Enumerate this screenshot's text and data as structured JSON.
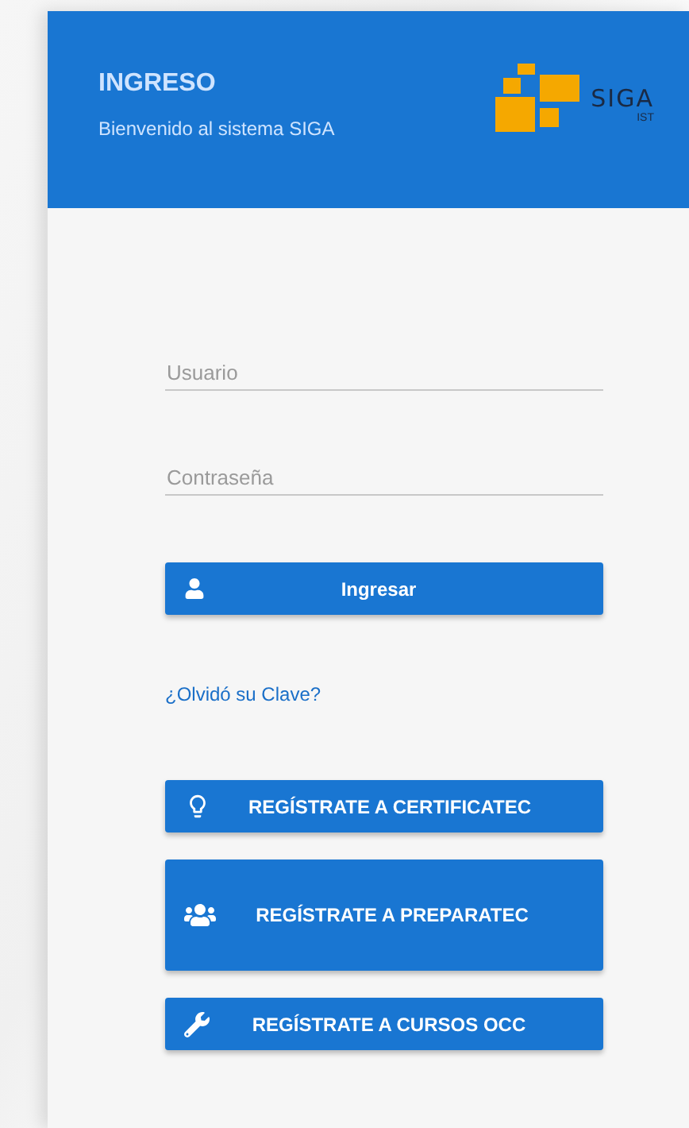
{
  "header": {
    "title": "INGRESO",
    "subtitle": "Bienvenido al sistema SIGA",
    "logo": {
      "name": "SIGA",
      "sub": "IST"
    }
  },
  "fields": [
    {
      "placeholder": "Usuario"
    },
    {
      "placeholder": "Contraseña"
    }
  ],
  "login_button": {
    "label": "Ingresar"
  },
  "forgot_link": "¿Olvidó su Clave?",
  "register_buttons": [
    {
      "label": "REGÍSTRATE A CERTIFICATEC",
      "kind": "bulb"
    },
    {
      "label": "REGÍSTRATE A PREPARATEC",
      "kind": "group"
    },
    {
      "label": "REGÍSTRATE A CURSOS OCC",
      "kind": "wrench"
    }
  ]
}
